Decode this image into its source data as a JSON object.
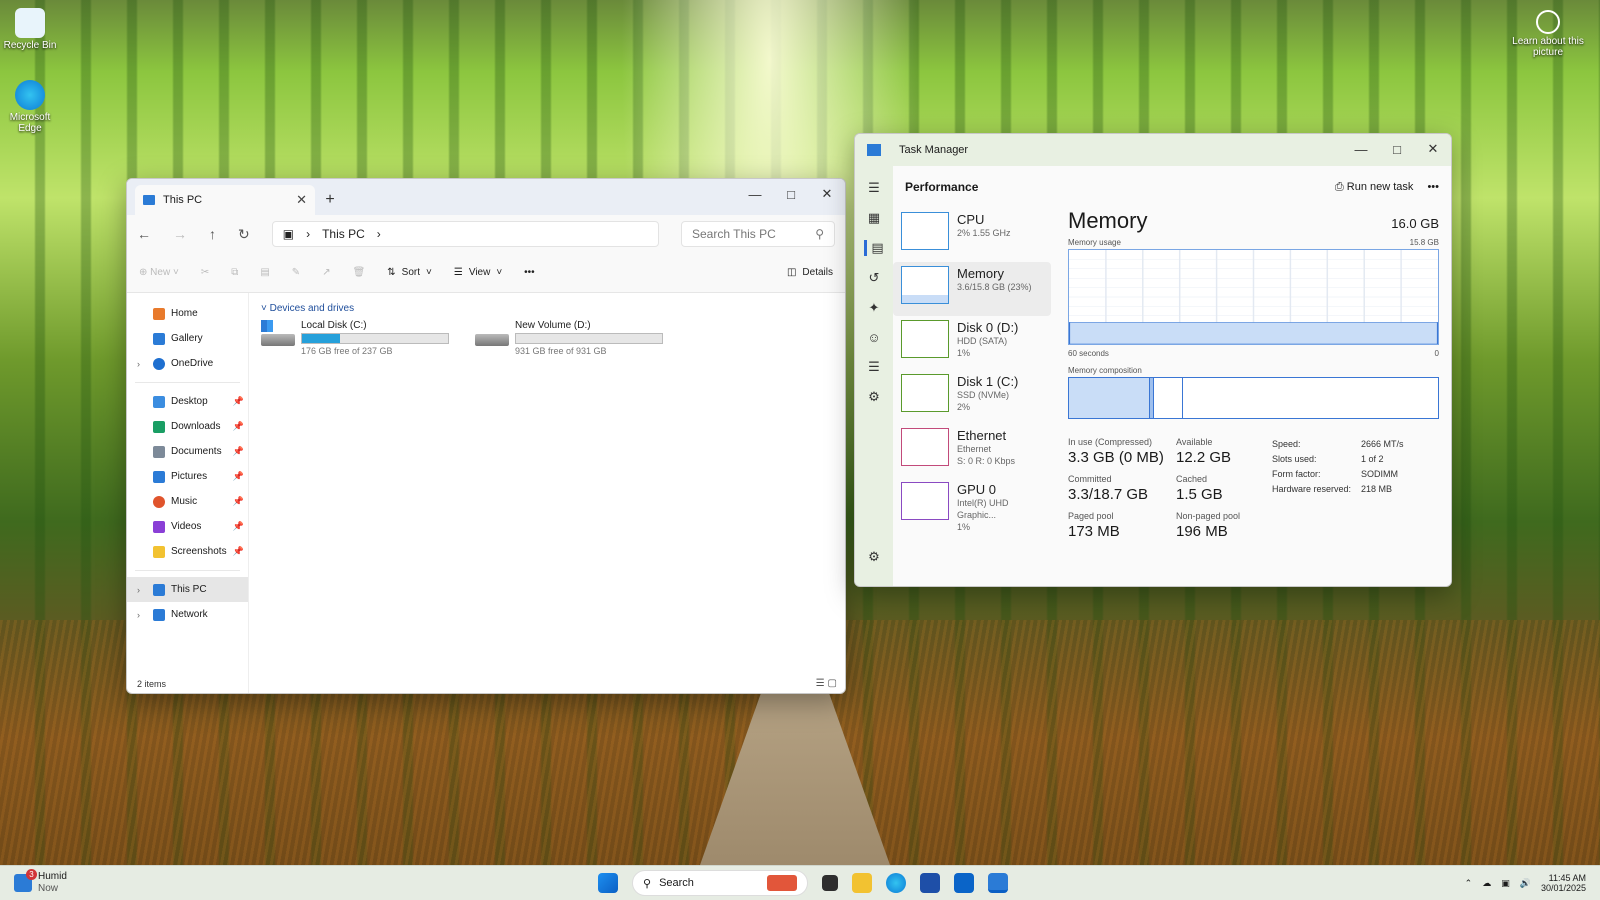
{
  "desktop": {
    "recycle_label": "Recycle Bin",
    "edge_label": "Microsoft Edge",
    "learn_label": "Learn about this picture"
  },
  "explorer": {
    "tab_title": "This PC",
    "close": "✕",
    "new_tab": "+",
    "address": "This PC",
    "search_placeholder": "Search This PC",
    "cmd": {
      "new": "New",
      "sort": "Sort",
      "view": "View",
      "details": "Details",
      "more": "•••"
    },
    "sidebar": [
      {
        "label": "Home"
      },
      {
        "label": "Gallery"
      },
      {
        "label": "OneDrive"
      },
      {
        "label": "Desktop"
      },
      {
        "label": "Downloads"
      },
      {
        "label": "Documents"
      },
      {
        "label": "Pictures"
      },
      {
        "label": "Music"
      },
      {
        "label": "Videos"
      },
      {
        "label": "Screenshots"
      },
      {
        "label": "This PC"
      },
      {
        "label": "Network"
      }
    ],
    "group": "Devices and drives",
    "drives": [
      {
        "name": "Local Disk (C:)",
        "free": "176 GB free of 237 GB",
        "used_fraction": 0.26
      },
      {
        "name": "New Volume (D:)",
        "free": "931 GB free of 931 GB",
        "used_fraction": 0.0
      }
    ],
    "status": "2 items"
  },
  "taskmgr": {
    "title": "Task Manager",
    "section": "Performance",
    "run_new_task": "Run new task",
    "more": "•••",
    "items": [
      {
        "label": "CPU",
        "sub1": "2% 1.55 GHz",
        "sub2": ""
      },
      {
        "label": "Memory",
        "sub1": "3.6/15.8 GB (23%)",
        "sub2": ""
      },
      {
        "label": "Disk 0 (D:)",
        "sub1": "HDD (SATA)",
        "sub2": "1%"
      },
      {
        "label": "Disk 1 (C:)",
        "sub1": "SSD (NVMe)",
        "sub2": "2%"
      },
      {
        "label": "Ethernet",
        "sub1": "Ethernet",
        "sub2": "S: 0 R: 0 Kbps"
      },
      {
        "label": "GPU 0",
        "sub1": "Intel(R) UHD Graphic...",
        "sub2": "1%"
      }
    ],
    "memory": {
      "title": "Memory",
      "total": "16.0 GB",
      "usage_label": "Memory usage",
      "usage_max": "15.8 GB",
      "time_left": "60 seconds",
      "time_right": "0",
      "composition_label": "Memory composition",
      "usage_fraction": 0.23,
      "in_use_label": "In use (Compressed)",
      "in_use": "3.3 GB (0 MB)",
      "available_label": "Available",
      "available": "12.2 GB",
      "committed_label": "Committed",
      "committed": "3.3/18.7 GB",
      "cached_label": "Cached",
      "cached": "1.5 GB",
      "paged_label": "Paged pool",
      "paged": "173 MB",
      "nonpaged_label": "Non-paged pool",
      "nonpaged": "196 MB",
      "speed_label": "Speed:",
      "speed": "2666 MT/s",
      "slots_label": "Slots used:",
      "slots": "1 of 2",
      "form_label": "Form factor:",
      "form": "SODIMM",
      "hw_label": "Hardware reserved:",
      "hw": "218 MB"
    }
  },
  "taskbar": {
    "weather_badge": "3",
    "weather_title": "Humid",
    "weather_sub": "Now",
    "search": "Search",
    "time": "11:45 AM",
    "date": "30/01/2025"
  }
}
